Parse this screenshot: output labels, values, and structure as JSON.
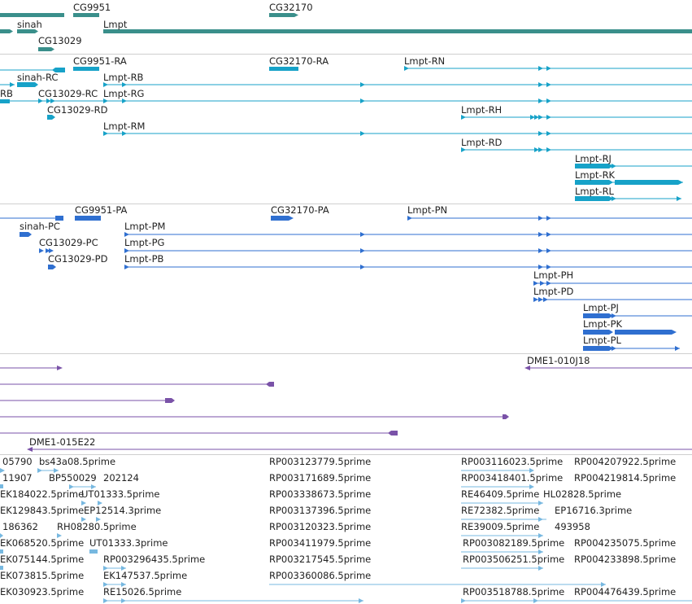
{
  "colors": {
    "gene": "#3a8f8b",
    "transcript": "#17a2c8",
    "protein": "#2f6fd0",
    "clone": "#7a52a8",
    "est": "#77b8e0"
  },
  "tracks": {
    "genes": {
      "labels": [
        "CG9951",
        "CG32170",
        "sinah",
        "Lmpt",
        "CG13029"
      ]
    },
    "transcripts": {
      "labels": [
        "CG9951-RA",
        "CG32170-RA",
        "Lmpt-RN",
        "sinah-RC",
        "Lmpt-RB",
        "RB",
        "CG13029-RC",
        "Lmpt-RG",
        "CG13029-RD",
        "Lmpt-RH",
        "Lmpt-RM",
        "Lmpt-RD",
        "Lmpt-RJ",
        "Lmpt-RK",
        "Lmpt-RL"
      ]
    },
    "proteins": {
      "labels": [
        "CG9951-PA",
        "CG32170-PA",
        "Lmpt-PN",
        "sinah-PC",
        "Lmpt-PM",
        "CG13029-PC",
        "Lmpt-PG",
        "CG13029-PD",
        "Lmpt-PB",
        "Lmpt-PH",
        "Lmpt-PD",
        "Lmpt-PJ",
        "Lmpt-PK",
        "Lmpt-PL"
      ]
    },
    "clones": {
      "labels": [
        "DME1-010J18",
        "DME1-015E22"
      ]
    },
    "ests": {
      "labels": [
        "05790",
        "bs43a08.5prime",
        "RP003123779.5prime",
        "RP003116023.5prime",
        "RP004207922.5prime",
        "11907",
        "BP550029",
        "202124",
        "RP003171689.5prime",
        "RP003418401.5prime",
        "RP004219814.5prime",
        "EK184022.5prime",
        "UT01333.5prime",
        "RP003338673.5prime",
        "RE46409.5prime",
        "HL02828.5prime",
        "EK129843.5prime",
        "EP12514.3prime",
        "RP003137396.5prime",
        "RE72382.5prime",
        "EP16716.3prime",
        "186362",
        "RH08280.5prime",
        "RP003120323.5prime",
        "RE39009.5prime",
        "493958",
        "EK068520.5prime",
        "UT01333.3prime",
        "RP003411979.5prime",
        "RP003082189.5prime",
        "RP004235075.5prime",
        "EK075144.5prime",
        "RP003296435.5prime",
        "RP003217545.5prime",
        "RP003506251.5prime",
        "RP004233898.5prime",
        "EK073815.5prime",
        "EK147537.5prime",
        "RP003360086.5prime",
        "EK030923.5prime",
        "RE15026.5prime",
        "RP003518788.5prime",
        "RP004476439.5prime"
      ]
    }
  }
}
